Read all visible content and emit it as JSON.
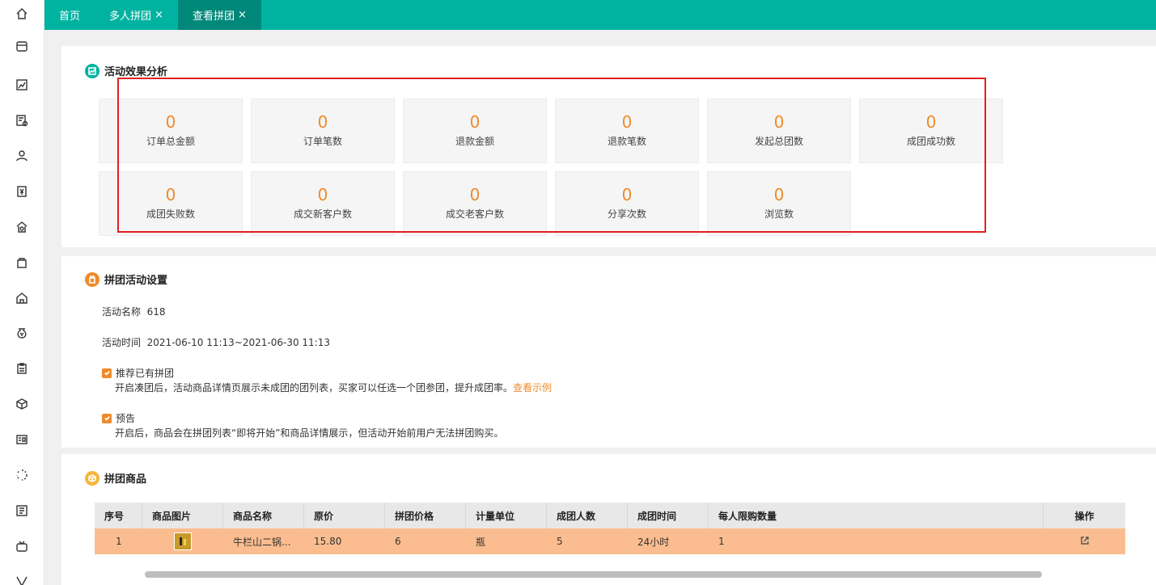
{
  "tabs": [
    {
      "label": "首页",
      "closable": false,
      "active": false
    },
    {
      "label": "多人拼团",
      "closable": true,
      "active": false
    },
    {
      "label": "查看拼团",
      "closable": true,
      "active": true
    }
  ],
  "tab_close_glyph": "×",
  "sidebar_icons": [
    "home-icon",
    "store-icon",
    "report-icon",
    "order-icon",
    "user-icon",
    "finance-icon",
    "shop-icon",
    "bag-icon",
    "warehouse-icon",
    "money-bag-icon",
    "clipboard-icon",
    "cube-icon",
    "id-card-icon",
    "loading-icon",
    "news-icon",
    "tv-icon",
    "vip-icon"
  ],
  "analysis": {
    "title": "活动效果分析",
    "stats": [
      {
        "value": "0",
        "label": "订单总金额"
      },
      {
        "value": "0",
        "label": "订单笔数"
      },
      {
        "value": "0",
        "label": "退款金额"
      },
      {
        "value": "0",
        "label": "退款笔数"
      },
      {
        "value": "0",
        "label": "发起总团数"
      },
      {
        "value": "0",
        "label": "成团成功数"
      },
      {
        "value": "0",
        "label": "成团失败数"
      },
      {
        "value": "0",
        "label": "成交新客户数"
      },
      {
        "value": "0",
        "label": "成交老客户数"
      },
      {
        "value": "0",
        "label": "分享次数"
      },
      {
        "value": "0",
        "label": "浏览数"
      }
    ]
  },
  "settings": {
    "title": "拼团活动设置",
    "name_label": "活动名称",
    "name_value": "618",
    "time_label": "活动时间",
    "time_value": "2021-06-10 11:13~2021-06-30 11:13",
    "options": [
      {
        "label": "推荐已有拼团",
        "checked": true,
        "desc": "开启凑团后，活动商品详情页展示未成团的团列表，买家可以任选一个团参团，提升成团率。",
        "link": "查看示例"
      },
      {
        "label": "预告",
        "checked": true,
        "desc": "开启后，商品会在拼团列表“即将开始”和商品详情展示，但活动开始前用户无法拼团购买。",
        "link": ""
      }
    ]
  },
  "goods": {
    "title": "拼团商品",
    "headers": [
      "序号",
      "商品图片",
      "商品名称",
      "原价",
      "拼团价格",
      "计量单位",
      "成团人数",
      "成团时间",
      "每人限购数量",
      "操作"
    ],
    "rows": [
      {
        "index": "1",
        "name": "牛栏山二锅...",
        "price": "15.80",
        "group_price": "6",
        "unit": "瓶",
        "group_size": "5",
        "group_time": "24小时",
        "limit": "1"
      }
    ]
  },
  "colors": {
    "accent": "#00b3a1",
    "accent_dark": "#00887a",
    "orange": "#f08a2a",
    "highlight_row": "#fbbd8f",
    "red_box": "#e02020"
  }
}
